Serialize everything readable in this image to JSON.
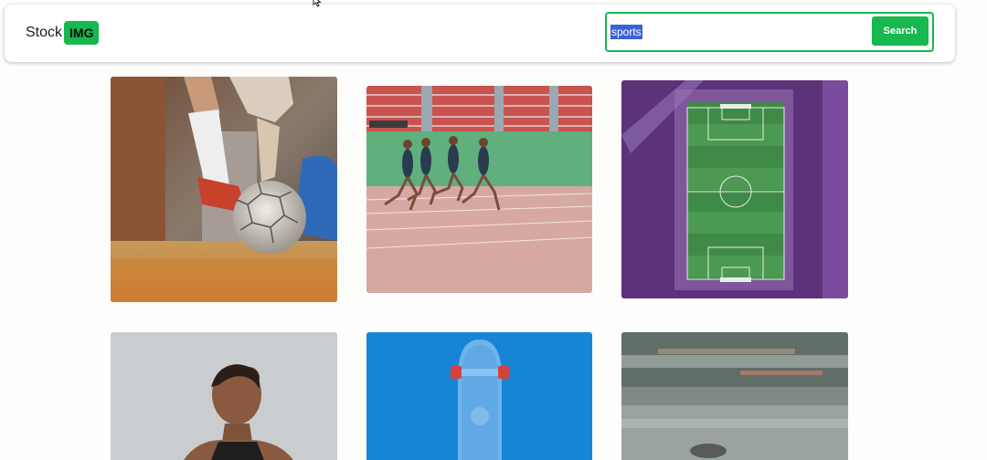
{
  "navbar": {
    "brand": {
      "text": "Stock",
      "badge": "IMG"
    },
    "search": {
      "value": "sports",
      "button_label": "Search"
    }
  },
  "gallery": {
    "images": [
      {
        "subject": "soccer-ball-kick"
      },
      {
        "subject": "track-runners"
      },
      {
        "subject": "aerial-soccer-field"
      },
      {
        "subject": "female-athlete-portrait"
      },
      {
        "subject": "blue-skateboard"
      },
      {
        "subject": "motion-blur-runner"
      }
    ]
  },
  "colors": {
    "accent": "#17b84f",
    "selection": "#3b62d6"
  }
}
